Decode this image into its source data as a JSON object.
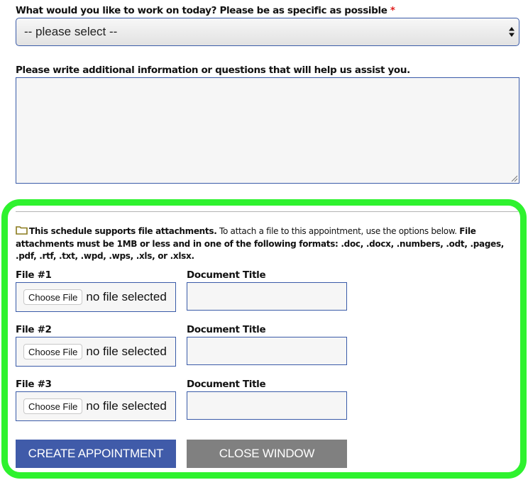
{
  "work_select": {
    "label": "What would you like to work on today? Please be as specific as possible",
    "required_mark": "*",
    "selected_value": "-- please select --",
    "icon": "up-down-arrows-icon"
  },
  "additional_info": {
    "label": "Please write additional information or questions that will help us assist you.",
    "value": ""
  },
  "attachments": {
    "icon": "folder-icon",
    "notice_bold_1": "This schedule supports file attachments.",
    "notice_text": " To attach a file to this appointment, use the options below. ",
    "notice_bold_2": "File attachments must be 1MB or less and in one of the following formats: .doc, .docx, .numbers, .odt, .pages, .pdf, .rtf, .txt, .wpd, .wps, .xls, or .xlsx.",
    "files": [
      {
        "label": "File #1",
        "choose_label": "Choose File",
        "status": "no file selected",
        "title_label": "Document Title",
        "title_value": ""
      },
      {
        "label": "File #2",
        "choose_label": "Choose File",
        "status": "no file selected",
        "title_label": "Document Title",
        "title_value": ""
      },
      {
        "label": "File #3",
        "choose_label": "Choose File",
        "status": "no file selected",
        "title_label": "Document Title",
        "title_value": ""
      }
    ]
  },
  "actions": {
    "create_label": "CREATE APPOINTMENT",
    "close_label": "CLOSE WINDOW"
  },
  "colors": {
    "highlight_border": "#2ef22e",
    "primary_button": "#405ba9",
    "secondary_button": "#808080",
    "required": "#e0201f",
    "input_border": "#3a5ba8"
  }
}
